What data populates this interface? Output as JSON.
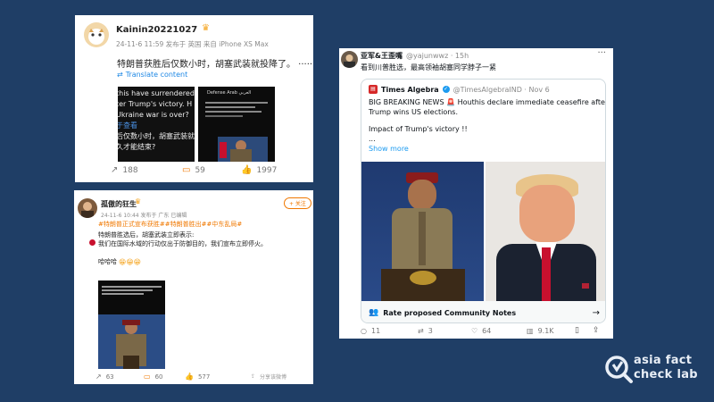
{
  "card1": {
    "username": "Kainin20221027",
    "meta": "24-11-6 11:59 发布于 英国 来自 iPhone XS Max",
    "text": "特朗普获胜后仅数小时，胡塞武装就投降了。 ·········",
    "translate": "Translate content",
    "img1_lines": [
      "this have surrendered",
      "ter Trump's victory. H",
      "Ukraine war is over?",
      "于查看",
      "后仅数小时，胡塞武装就投降",
      "久才能结束?"
    ],
    "img2_header": "Defense Arab العربي",
    "counts": {
      "share": "188",
      "comment": "59",
      "like": "1997"
    }
  },
  "card2": {
    "username": "孤傲的狂生",
    "meta": "24-11-6 10:44 发布于 广东  已编辑",
    "follow": "+ 关注",
    "tags": "#特朗普正式宣布获胜##特朗普胜出##中东乱局#",
    "line1": "特朗普胜选后，胡塞武装立即表示:",
    "line2": "我们在国际水域的行动仅出于防御目的，我们宣布立即停火。",
    "laugh": "哈哈哈",
    "counts": {
      "share": "63",
      "comment": "60",
      "like": "577"
    },
    "share_label": "分享该微博"
  },
  "card3": {
    "username": "亚军&王歪嘴",
    "handle": "@yajunwwz · 15h",
    "text": "看到川普胜选，最高领袖胡塞同学脖子一紧",
    "quote": {
      "name": "Times Algebra",
      "handle": "@TimesAlgebraIND · Nov 6",
      "line1": "BIG BREAKING NEWS",
      "line1b": "Houthis declare immediate ceasefire after",
      "line2": "Trump wins US elections.",
      "line3": "Impact of Trump's victory !!",
      "line4": "...",
      "show_more": "Show more"
    },
    "community_notes": "Rate proposed Community Notes",
    "counts": {
      "reply": "11",
      "retweet": "3",
      "like": "64",
      "views": "9.1K"
    }
  },
  "watermark": {
    "line1": "asia fact",
    "line2": "check lab"
  },
  "colors": {
    "background": "#1f3e66",
    "twitter_blue": "#1d9bf0",
    "weibo_orange": "#f07800"
  }
}
